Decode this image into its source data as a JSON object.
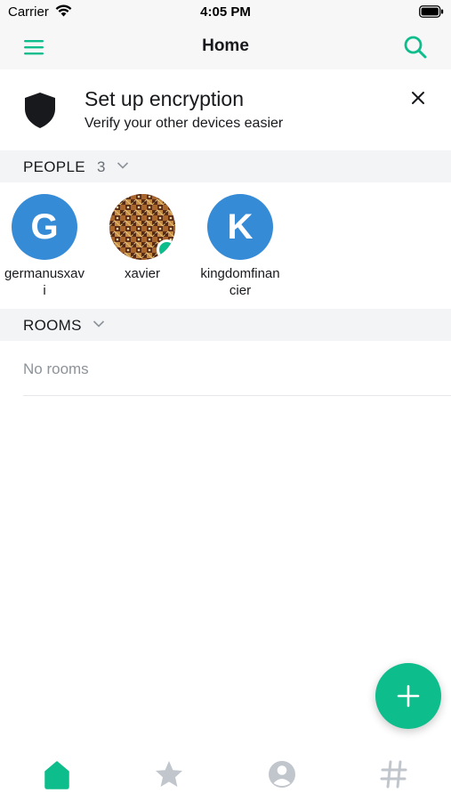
{
  "status_bar": {
    "carrier": "Carrier",
    "time": "4:05 PM"
  },
  "nav": {
    "title": "Home",
    "menu_icon": "hamburger-menu-icon",
    "search_icon": "search-icon"
  },
  "banner": {
    "icon": "shield-icon",
    "title": "Set up encryption",
    "subtitle": "Verify your other devices easier",
    "close_icon": "close-icon"
  },
  "people": {
    "header": "PEOPLE",
    "count": "3",
    "items": [
      {
        "initial": "G",
        "name": "germanusxavi",
        "online": false
      },
      {
        "initial": "",
        "name": "xavier",
        "online": true
      },
      {
        "initial": "K",
        "name": "kingdomfinancier",
        "online": false
      }
    ]
  },
  "rooms": {
    "header": "ROOMS",
    "empty_text": "No rooms"
  },
  "fab": {
    "icon": "plus-icon"
  },
  "tabs": [
    {
      "icon": "home-icon",
      "active": true
    },
    {
      "icon": "star-icon",
      "active": false
    },
    {
      "icon": "person-icon",
      "active": false
    },
    {
      "icon": "hashtag-icon",
      "active": false
    }
  ],
  "colors": {
    "accent": "#0dbd8b",
    "avatar_blue": "#368bd6",
    "inactive_tab": "#c1c6cd"
  }
}
